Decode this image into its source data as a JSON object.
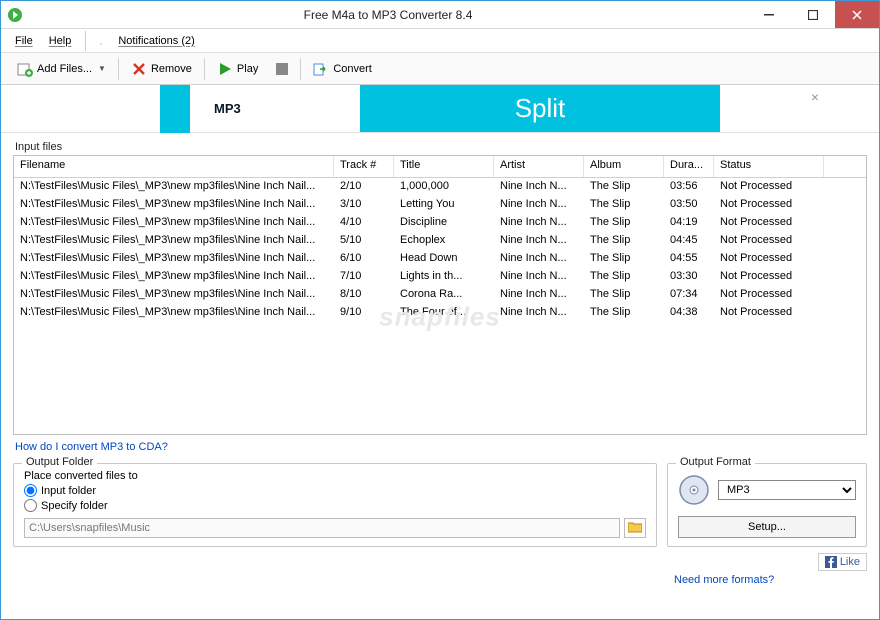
{
  "window": {
    "title": "Free M4a to MP3 Converter 8.4"
  },
  "menu": {
    "file": "File",
    "help": "Help",
    "notifications": "Notifications (2)"
  },
  "toolbar": {
    "add_files": "Add Files...",
    "remove": "Remove",
    "play": "Play",
    "convert": "Convert"
  },
  "banner": {
    "left_label": "MP3",
    "right_label": "Split"
  },
  "input_group_label": "Input files",
  "columns": {
    "filename": "Filename",
    "track": "Track #",
    "title": "Title",
    "artist": "Artist",
    "album": "Album",
    "duration": "Dura...",
    "status": "Status"
  },
  "files": [
    {
      "filename": "N:\\TestFiles\\Music Files\\_MP3\\new mp3files\\Nine Inch Nail...",
      "track": "2/10",
      "title": "1,000,000",
      "artist": "Nine Inch N...",
      "album": "The Slip",
      "duration": "03:56",
      "status": "Not Processed"
    },
    {
      "filename": "N:\\TestFiles\\Music Files\\_MP3\\new mp3files\\Nine Inch Nail...",
      "track": "3/10",
      "title": "Letting You",
      "artist": "Nine Inch N...",
      "album": "The Slip",
      "duration": "03:50",
      "status": "Not Processed"
    },
    {
      "filename": "N:\\TestFiles\\Music Files\\_MP3\\new mp3files\\Nine Inch Nail...",
      "track": "4/10",
      "title": "Discipline",
      "artist": "Nine Inch N...",
      "album": "The Slip",
      "duration": "04:19",
      "status": "Not Processed"
    },
    {
      "filename": "N:\\TestFiles\\Music Files\\_MP3\\new mp3files\\Nine Inch Nail...",
      "track": "5/10",
      "title": "Echoplex",
      "artist": "Nine Inch N...",
      "album": "The Slip",
      "duration": "04:45",
      "status": "Not Processed"
    },
    {
      "filename": "N:\\TestFiles\\Music Files\\_MP3\\new mp3files\\Nine Inch Nail...",
      "track": "6/10",
      "title": "Head Down",
      "artist": "Nine Inch N...",
      "album": "The Slip",
      "duration": "04:55",
      "status": "Not Processed"
    },
    {
      "filename": "N:\\TestFiles\\Music Files\\_MP3\\new mp3files\\Nine Inch Nail...",
      "track": "7/10",
      "title": "Lights in th...",
      "artist": "Nine Inch N...",
      "album": "The Slip",
      "duration": "03:30",
      "status": "Not Processed"
    },
    {
      "filename": "N:\\TestFiles\\Music Files\\_MP3\\new mp3files\\Nine Inch Nail...",
      "track": "8/10",
      "title": "Corona Ra...",
      "artist": "Nine Inch N...",
      "album": "The Slip",
      "duration": "07:34",
      "status": "Not Processed"
    },
    {
      "filename": "N:\\TestFiles\\Music Files\\_MP3\\new mp3files\\Nine Inch Nail...",
      "track": "9/10",
      "title": "The Four of...",
      "artist": "Nine Inch N...",
      "album": "The Slip",
      "duration": "04:38",
      "status": "Not Processed"
    }
  ],
  "help_link": "How do I convert MP3 to CDA?",
  "output_folder": {
    "legend": "Output Folder",
    "place_label": "Place converted files to",
    "opt_input": "Input folder",
    "opt_specify": "Specify folder",
    "path": "C:\\Users\\snapfiles\\Music"
  },
  "output_format": {
    "legend": "Output Format",
    "selected": "MP3",
    "setup": "Setup..."
  },
  "more_formats": "Need more formats?",
  "fb_like": "Like",
  "watermark": "snapfiles"
}
